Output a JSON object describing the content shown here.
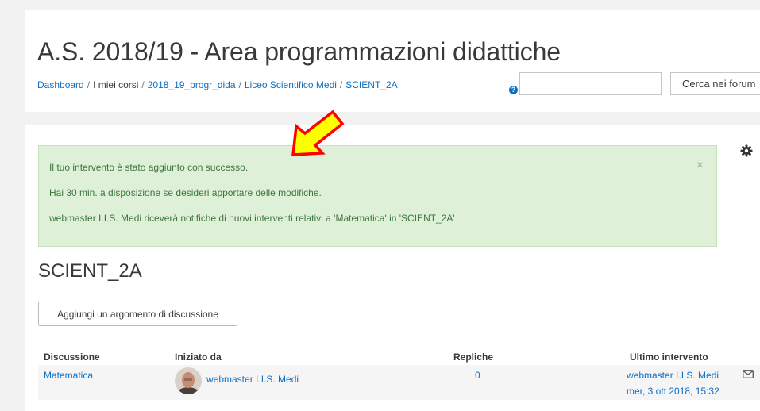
{
  "header": {
    "title": "A.S. 2018/19 - Area programmazioni didattiche",
    "breadcrumb": [
      {
        "label": "Dashboard",
        "link": true
      },
      {
        "label": "I miei corsi",
        "link": false
      },
      {
        "label": "2018_19_progr_dida",
        "link": true
      },
      {
        "label": "Liceo Scientifico Medi",
        "link": true
      },
      {
        "label": "SCIENT_2A",
        "link": true
      }
    ],
    "help_icon": "question-circle-icon",
    "search": {
      "placeholder": "",
      "value": "",
      "button_label": "Cerca nei forum"
    }
  },
  "alert": {
    "lines": [
      "Il tuo intervento è stato aggiunto con successo.",
      "Hai 30 min. a disposizione se desideri apportare delle modifiche.",
      "webmaster I.I.S. Medi riceverà notifiche di nuovi interventi relativi a 'Matematica' in 'SCIENT_2A'"
    ],
    "close_glyph": "×",
    "color": "#3c763d",
    "background": "#dff0d8"
  },
  "forum": {
    "title": "SCIENT_2A",
    "add_topic_label": "Aggiungi un argomento di discussione",
    "table": {
      "headers": {
        "discussion": "Discussione",
        "started_by": "Iniziato da",
        "replies": "Repliche",
        "last_post": "Ultimo intervento"
      },
      "rows": [
        {
          "discussion": "Matematica",
          "started_by": "webmaster I.I.S. Medi",
          "replies": "0",
          "last_post_author": "webmaster I.I.S. Medi",
          "last_post_date": "mer, 3 ott 2018, 15:32"
        }
      ]
    }
  },
  "icons": {
    "gear": "gear-icon",
    "mail": "mail-icon",
    "arrow": "yellow-arrow-annotation"
  },
  "colors": {
    "link": "#0f6fc5",
    "text": "#373a3c",
    "arrow_fill": "#ffff00",
    "arrow_stroke": "#ff0000"
  }
}
